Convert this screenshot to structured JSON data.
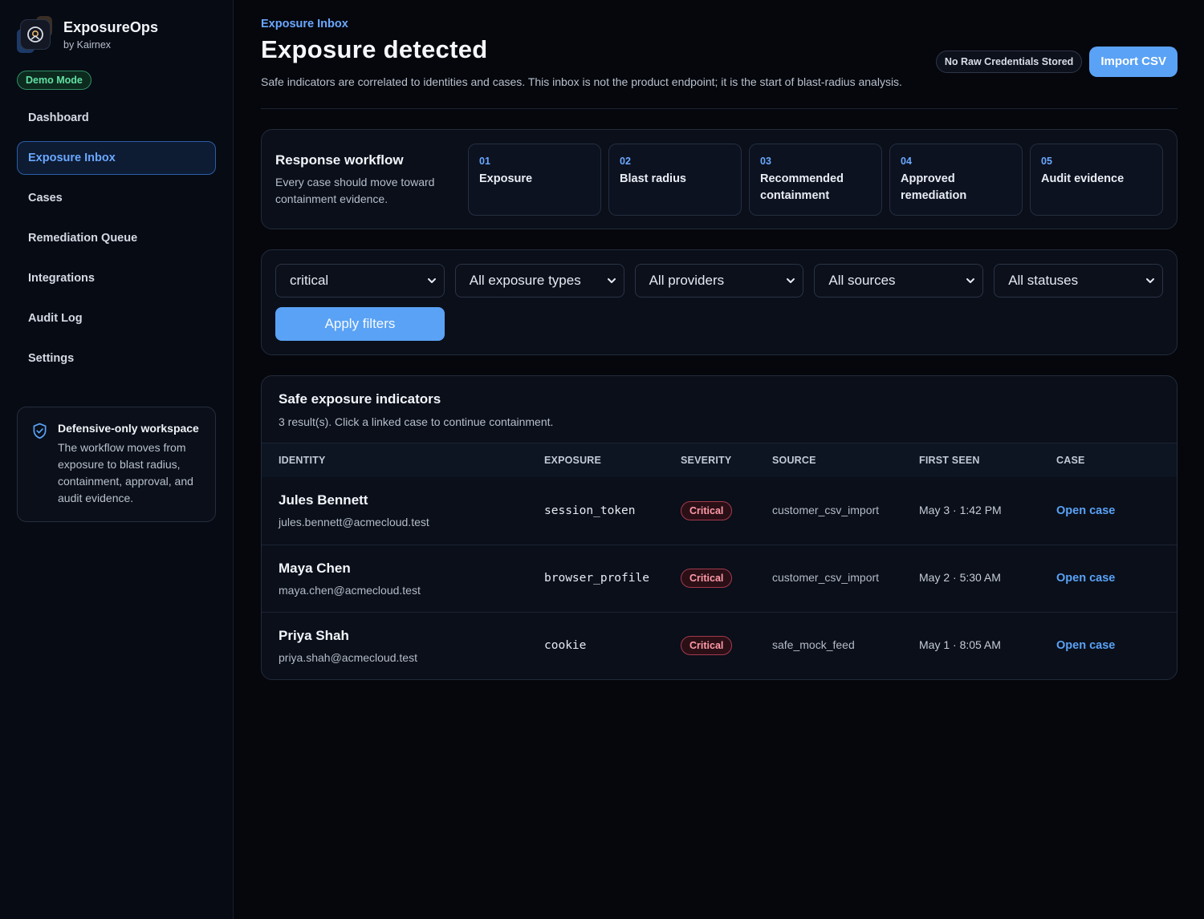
{
  "app": {
    "name": "ExposureOps",
    "subtitle": "by Kairnex",
    "mode_badge": "Demo Mode"
  },
  "sidebar": {
    "items": [
      {
        "label": "Dashboard",
        "active": false
      },
      {
        "label": "Exposure Inbox",
        "active": true
      },
      {
        "label": "Cases",
        "active": false
      },
      {
        "label": "Remediation Queue",
        "active": false
      },
      {
        "label": "Integrations",
        "active": false
      },
      {
        "label": "Audit Log",
        "active": false
      },
      {
        "label": "Settings",
        "active": false
      }
    ],
    "workspace_card": {
      "icon": "shield-check-icon",
      "title": "Defensive-only workspace",
      "text": "The workflow moves from exposure to blast radius, containment, approval, and audit evidence."
    }
  },
  "header": {
    "eyebrow": "Exposure Inbox",
    "title": "Exposure detected",
    "description": "Safe indicators are correlated to identities and cases. This inbox is not the product endpoint; it is the start of blast-radius analysis.",
    "badge": "No Raw Credentials Stored",
    "import_button": "Import CSV"
  },
  "workflow": {
    "title": "Response workflow",
    "description": "Every case should move toward containment evidence.",
    "steps": [
      {
        "num": "01",
        "label": "Exposure"
      },
      {
        "num": "02",
        "label": "Blast radius"
      },
      {
        "num": "03",
        "label": "Recommended containment"
      },
      {
        "num": "04",
        "label": "Approved remediation"
      },
      {
        "num": "05",
        "label": "Audit evidence"
      }
    ]
  },
  "filters": {
    "severity": "critical",
    "exposure_type": "All exposure types",
    "provider": "All providers",
    "source": "All sources",
    "status": "All statuses",
    "apply_label": "Apply filters"
  },
  "indicators": {
    "title": "Safe exposure indicators",
    "summary": "3 result(s). Click a linked case to continue containment.",
    "columns": [
      "IDENTITY",
      "EXPOSURE",
      "SEVERITY",
      "SOURCE",
      "FIRST SEEN",
      "CASE"
    ],
    "rows": [
      {
        "name": "Jules Bennett",
        "email": "jules.bennett@acmecloud.test",
        "exposure": "session_token",
        "severity": "Critical",
        "source": "customer_csv_import",
        "first_seen": "May 3 · 1:42 PM",
        "case": "Open case"
      },
      {
        "name": "Maya Chen",
        "email": "maya.chen@acmecloud.test",
        "exposure": "browser_profile",
        "severity": "Critical",
        "source": "customer_csv_import",
        "first_seen": "May 2 · 5:30 AM",
        "case": "Open case"
      },
      {
        "name": "Priya Shah",
        "email": "priya.shah@acmecloud.test",
        "exposure": "cookie",
        "severity": "Critical",
        "source": "safe_mock_feed",
        "first_seen": "May 1 · 8:05 AM",
        "case": "Open case"
      }
    ]
  },
  "colors": {
    "accent": "#5aa2f5",
    "background": "#05070d",
    "success": "#62e0a3",
    "critical": "#ff9aa8"
  }
}
